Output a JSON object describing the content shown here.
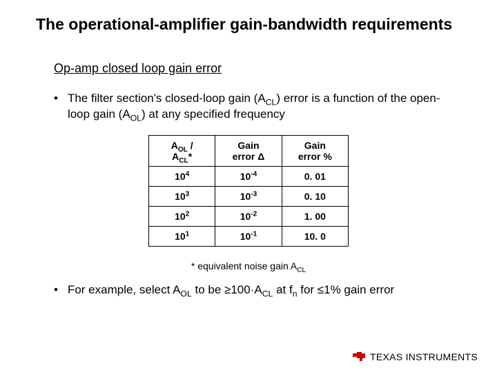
{
  "title": "The operational-amplifier gain-bandwidth requirements",
  "subtitle": "Op-amp closed loop gain error",
  "bullet1": {
    "pre": "The filter section's closed-loop gain (A",
    "sub1": "CL",
    "mid": ") error is a function of the open-loop gain (A",
    "sub2": "OL",
    "post": ") at any specified frequency"
  },
  "table": {
    "headers": {
      "col1": {
        "a": "A",
        "asub": "OL",
        "slash": " / ",
        "b": "A",
        "bsub": "CL",
        "star": "*"
      },
      "col2": {
        "line1": "Gain",
        "line2a": "error ",
        "line2b": "Δ"
      },
      "col3": {
        "line1": "Gain",
        "line2": "error %"
      }
    },
    "rows": [
      {
        "ratio_base": "10",
        "ratio_exp": "4",
        "delta_base": "10",
        "delta_exp": "-4",
        "pct": "0. 01"
      },
      {
        "ratio_base": "10",
        "ratio_exp": "3",
        "delta_base": "10",
        "delta_exp": "-3",
        "pct": "0. 10"
      },
      {
        "ratio_base": "10",
        "ratio_exp": "2",
        "delta_base": "10",
        "delta_exp": "-2",
        "pct": "1. 00"
      },
      {
        "ratio_base": "10",
        "ratio_exp": "1",
        "delta_base": "10",
        "delta_exp": "-1",
        "pct": "10. 0"
      }
    ]
  },
  "footnote": {
    "pre": "* equivalent noise gain A",
    "sub": "CL"
  },
  "bullet2": {
    "p1": "For example, select A",
    "s1": "OL",
    "p2": " to be ≥100·A",
    "s2": "CL",
    "p3": " at f",
    "s3": "n",
    "p4": " for ≤1% gain error"
  },
  "logo": {
    "brand": "TEXAS INSTRUMENTS",
    "icon": "ti-chip-icon",
    "color": "#cc0000"
  }
}
